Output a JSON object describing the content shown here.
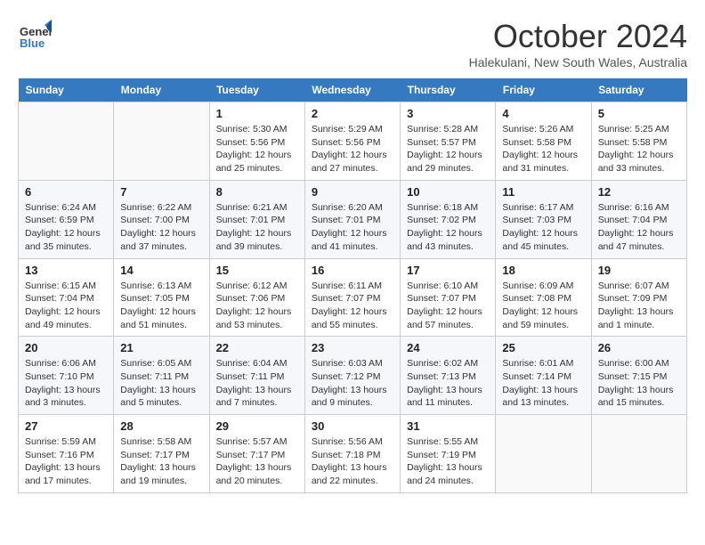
{
  "logo": {
    "line1": "General",
    "line2": "Blue"
  },
  "title": "October 2024",
  "subtitle": "Halekulani, New South Wales, Australia",
  "days_header": [
    "Sunday",
    "Monday",
    "Tuesday",
    "Wednesday",
    "Thursday",
    "Friday",
    "Saturday"
  ],
  "weeks": [
    [
      {
        "day": "",
        "sunrise": "",
        "sunset": "",
        "daylight": ""
      },
      {
        "day": "",
        "sunrise": "",
        "sunset": "",
        "daylight": ""
      },
      {
        "day": "1",
        "sunrise": "Sunrise: 5:30 AM",
        "sunset": "Sunset: 5:56 PM",
        "daylight": "Daylight: 12 hours and 25 minutes."
      },
      {
        "day": "2",
        "sunrise": "Sunrise: 5:29 AM",
        "sunset": "Sunset: 5:56 PM",
        "daylight": "Daylight: 12 hours and 27 minutes."
      },
      {
        "day": "3",
        "sunrise": "Sunrise: 5:28 AM",
        "sunset": "Sunset: 5:57 PM",
        "daylight": "Daylight: 12 hours and 29 minutes."
      },
      {
        "day": "4",
        "sunrise": "Sunrise: 5:26 AM",
        "sunset": "Sunset: 5:58 PM",
        "daylight": "Daylight: 12 hours and 31 minutes."
      },
      {
        "day": "5",
        "sunrise": "Sunrise: 5:25 AM",
        "sunset": "Sunset: 5:58 PM",
        "daylight": "Daylight: 12 hours and 33 minutes."
      }
    ],
    [
      {
        "day": "6",
        "sunrise": "Sunrise: 6:24 AM",
        "sunset": "Sunset: 6:59 PM",
        "daylight": "Daylight: 12 hours and 35 minutes."
      },
      {
        "day": "7",
        "sunrise": "Sunrise: 6:22 AM",
        "sunset": "Sunset: 7:00 PM",
        "daylight": "Daylight: 12 hours and 37 minutes."
      },
      {
        "day": "8",
        "sunrise": "Sunrise: 6:21 AM",
        "sunset": "Sunset: 7:01 PM",
        "daylight": "Daylight: 12 hours and 39 minutes."
      },
      {
        "day": "9",
        "sunrise": "Sunrise: 6:20 AM",
        "sunset": "Sunset: 7:01 PM",
        "daylight": "Daylight: 12 hours and 41 minutes."
      },
      {
        "day": "10",
        "sunrise": "Sunrise: 6:18 AM",
        "sunset": "Sunset: 7:02 PM",
        "daylight": "Daylight: 12 hours and 43 minutes."
      },
      {
        "day": "11",
        "sunrise": "Sunrise: 6:17 AM",
        "sunset": "Sunset: 7:03 PM",
        "daylight": "Daylight: 12 hours and 45 minutes."
      },
      {
        "day": "12",
        "sunrise": "Sunrise: 6:16 AM",
        "sunset": "Sunset: 7:04 PM",
        "daylight": "Daylight: 12 hours and 47 minutes."
      }
    ],
    [
      {
        "day": "13",
        "sunrise": "Sunrise: 6:15 AM",
        "sunset": "Sunset: 7:04 PM",
        "daylight": "Daylight: 12 hours and 49 minutes."
      },
      {
        "day": "14",
        "sunrise": "Sunrise: 6:13 AM",
        "sunset": "Sunset: 7:05 PM",
        "daylight": "Daylight: 12 hours and 51 minutes."
      },
      {
        "day": "15",
        "sunrise": "Sunrise: 6:12 AM",
        "sunset": "Sunset: 7:06 PM",
        "daylight": "Daylight: 12 hours and 53 minutes."
      },
      {
        "day": "16",
        "sunrise": "Sunrise: 6:11 AM",
        "sunset": "Sunset: 7:07 PM",
        "daylight": "Daylight: 12 hours and 55 minutes."
      },
      {
        "day": "17",
        "sunrise": "Sunrise: 6:10 AM",
        "sunset": "Sunset: 7:07 PM",
        "daylight": "Daylight: 12 hours and 57 minutes."
      },
      {
        "day": "18",
        "sunrise": "Sunrise: 6:09 AM",
        "sunset": "Sunset: 7:08 PM",
        "daylight": "Daylight: 12 hours and 59 minutes."
      },
      {
        "day": "19",
        "sunrise": "Sunrise: 6:07 AM",
        "sunset": "Sunset: 7:09 PM",
        "daylight": "Daylight: 13 hours and 1 minute."
      }
    ],
    [
      {
        "day": "20",
        "sunrise": "Sunrise: 6:06 AM",
        "sunset": "Sunset: 7:10 PM",
        "daylight": "Daylight: 13 hours and 3 minutes."
      },
      {
        "day": "21",
        "sunrise": "Sunrise: 6:05 AM",
        "sunset": "Sunset: 7:11 PM",
        "daylight": "Daylight: 13 hours and 5 minutes."
      },
      {
        "day": "22",
        "sunrise": "Sunrise: 6:04 AM",
        "sunset": "Sunset: 7:11 PM",
        "daylight": "Daylight: 13 hours and 7 minutes."
      },
      {
        "day": "23",
        "sunrise": "Sunrise: 6:03 AM",
        "sunset": "Sunset: 7:12 PM",
        "daylight": "Daylight: 13 hours and 9 minutes."
      },
      {
        "day": "24",
        "sunrise": "Sunrise: 6:02 AM",
        "sunset": "Sunset: 7:13 PM",
        "daylight": "Daylight: 13 hours and 11 minutes."
      },
      {
        "day": "25",
        "sunrise": "Sunrise: 6:01 AM",
        "sunset": "Sunset: 7:14 PM",
        "daylight": "Daylight: 13 hours and 13 minutes."
      },
      {
        "day": "26",
        "sunrise": "Sunrise: 6:00 AM",
        "sunset": "Sunset: 7:15 PM",
        "daylight": "Daylight: 13 hours and 15 minutes."
      }
    ],
    [
      {
        "day": "27",
        "sunrise": "Sunrise: 5:59 AM",
        "sunset": "Sunset: 7:16 PM",
        "daylight": "Daylight: 13 hours and 17 minutes."
      },
      {
        "day": "28",
        "sunrise": "Sunrise: 5:58 AM",
        "sunset": "Sunset: 7:17 PM",
        "daylight": "Daylight: 13 hours and 19 minutes."
      },
      {
        "day": "29",
        "sunrise": "Sunrise: 5:57 AM",
        "sunset": "Sunset: 7:17 PM",
        "daylight": "Daylight: 13 hours and 20 minutes."
      },
      {
        "day": "30",
        "sunrise": "Sunrise: 5:56 AM",
        "sunset": "Sunset: 7:18 PM",
        "daylight": "Daylight: 13 hours and 22 minutes."
      },
      {
        "day": "31",
        "sunrise": "Sunrise: 5:55 AM",
        "sunset": "Sunset: 7:19 PM",
        "daylight": "Daylight: 13 hours and 24 minutes."
      },
      {
        "day": "",
        "sunrise": "",
        "sunset": "",
        "daylight": ""
      },
      {
        "day": "",
        "sunrise": "",
        "sunset": "",
        "daylight": ""
      }
    ]
  ]
}
